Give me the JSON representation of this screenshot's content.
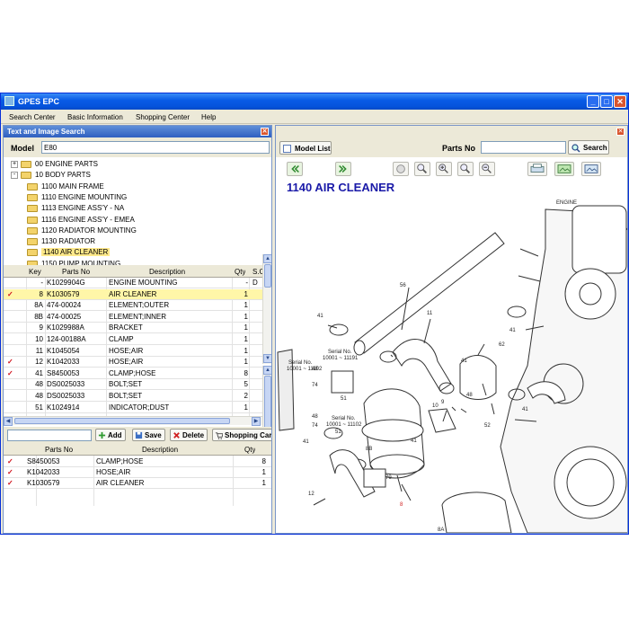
{
  "window": {
    "title": "GPES EPC"
  },
  "menu": [
    {
      "label": "Search Center"
    },
    {
      "label": "Basic Information"
    },
    {
      "label": "Shopping Center"
    },
    {
      "label": "Help"
    }
  ],
  "left_pane": {
    "title": "Text and Image Search",
    "model_label": "Model",
    "model_value": "E80"
  },
  "tree": [
    {
      "label": "00 ENGINE PARTS",
      "level": 0,
      "expander": "+"
    },
    {
      "label": "10 BODY PARTS",
      "level": 0,
      "expander": "-"
    },
    {
      "label": "1100 MAIN FRAME",
      "level": 1
    },
    {
      "label": "1110 ENGINE MOUNTING",
      "level": 1
    },
    {
      "label": "1113 ENGINE ASS'Y - NA",
      "level": 1
    },
    {
      "label": "1116 ENGINE ASS'Y - EMEA",
      "level": 1
    },
    {
      "label": "1120 RADIATOR MOUNTING",
      "level": 1
    },
    {
      "label": "1130 RADIATOR",
      "level": 1
    },
    {
      "label": "1140 AIR CLEANER",
      "level": 1,
      "selected": true
    },
    {
      "label": "1150 PUMP MOUNTING",
      "level": 1
    }
  ],
  "parts_table": {
    "headers": {
      "key": "Key",
      "parts_no": "Parts No",
      "description": "Description",
      "qty": "Qty",
      "sc": "S.C"
    },
    "rows": [
      {
        "check": "",
        "key": "-",
        "parts_no": "K1029904G",
        "description": "ENGINE MOUNTING",
        "qty": "-",
        "sc": "D"
      },
      {
        "check": "✓",
        "key": "8",
        "parts_no": "K1030579",
        "description": "AIR CLEANER",
        "qty": "1",
        "sc": "",
        "highlight": true
      },
      {
        "check": "",
        "key": "8A",
        "parts_no": "474-00024",
        "description": "ELEMENT;OUTER",
        "qty": "1",
        "sc": ""
      },
      {
        "check": "",
        "key": "8B",
        "parts_no": "474-00025",
        "description": "ELEMENT;INNER",
        "qty": "1",
        "sc": ""
      },
      {
        "check": "",
        "key": "9",
        "parts_no": "K1029988A",
        "description": "BRACKET",
        "qty": "1",
        "sc": ""
      },
      {
        "check": "",
        "key": "10",
        "parts_no": "124-00188A",
        "description": "CLAMP",
        "qty": "1",
        "sc": ""
      },
      {
        "check": "",
        "key": "11",
        "parts_no": "K1045054",
        "description": "HOSE;AIR",
        "qty": "1",
        "sc": ""
      },
      {
        "check": "✓",
        "key": "12",
        "parts_no": "K1042033",
        "description": "HOSE;AIR",
        "qty": "1",
        "sc": ""
      },
      {
        "check": "✓",
        "key": "41",
        "parts_no": "S8450053",
        "description": "CLAMP;HOSE",
        "qty": "8",
        "sc": ""
      },
      {
        "check": "",
        "key": "48",
        "parts_no": "DS0025033",
        "description": "BOLT;SET",
        "qty": "5",
        "sc": ""
      },
      {
        "check": "",
        "key": "48",
        "parts_no": "DS0025033",
        "description": "BOLT;SET",
        "qty": "2",
        "sc": ""
      },
      {
        "check": "",
        "key": "51",
        "parts_no": "K1024914",
        "description": "INDICATOR;DUST",
        "qty": "1",
        "sc": ""
      }
    ]
  },
  "toolbar": {
    "add_label": "Add",
    "save_label": "Save",
    "delete_label": "Delete",
    "shopping_label": "Shopping Car"
  },
  "cart_table": {
    "headers": {
      "parts_no": "Parts No",
      "description": "Description",
      "qty": "Qty"
    },
    "rows": [
      {
        "check": "✓",
        "parts_no": "S8450053",
        "description": "CLAMP;HOSE",
        "qty": "8"
      },
      {
        "check": "✓",
        "parts_no": "K1042033",
        "description": "HOSE;AIR",
        "qty": "1"
      },
      {
        "check": "✓",
        "parts_no": "K1030579",
        "description": "AIR CLEANER",
        "qty": "1"
      }
    ]
  },
  "right_pane": {
    "model_list_label": "Model List",
    "parts_no_label": "Parts No",
    "parts_no_value": "",
    "search_label": "Search",
    "drawing_title": "1140 AIR CLEANER",
    "drawing_labels": {
      "engine": "ENGINE",
      "serial1": "Serial No.",
      "serial1_range": "10001 ~ 11102",
      "serial2": "Serial No.",
      "serial2_range": "10001 ~ 11191",
      "serial3": "Serial No.",
      "serial3_range": "10001 ~ 11102",
      "n56": "56",
      "n41a": "41",
      "n11": "11",
      "n41b": "41",
      "n62": "62",
      "n48a": "48",
      "n74a": "74",
      "n51a": "51",
      "n51b": "51",
      "n41c": "41",
      "n48b": "48",
      "n74b": "74",
      "n41d": "41",
      "n10": "10",
      "n9": "9",
      "n48c": "48",
      "n52": "52",
      "n41e": "41",
      "n41f": "41",
      "n12": "12",
      "n79": "79",
      "n8": "8",
      "n8a": "8A",
      "n8b": "8B"
    }
  },
  "colors": {
    "titlebar": "#0553dc",
    "highlight_row": "#fff6a8",
    "check": "#d0101a",
    "drawing_title": "#1a1aa8"
  }
}
